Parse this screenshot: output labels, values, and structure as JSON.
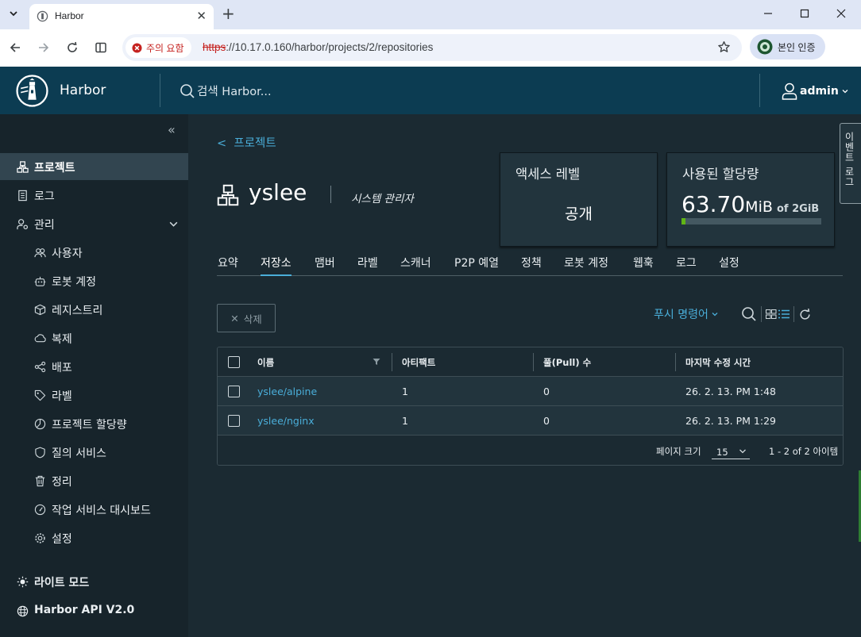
{
  "browser": {
    "tab_title": "Harbor",
    "security_label": "주의 요함",
    "url_scheme": "https",
    "url_rest": "://10.17.0.160/harbor/projects/2/repositories",
    "profile_label": "본인 인증"
  },
  "header": {
    "app_name": "Harbor",
    "search_placeholder": "검색 Harbor...",
    "user": "admin",
    "brand_color": "#0c3c52"
  },
  "sidebar": {
    "items": [
      {
        "label": "프로젝트",
        "icon": "projects-icon"
      },
      {
        "label": "로그",
        "icon": "log-icon"
      },
      {
        "label": "관리",
        "icon": "admin-icon"
      },
      {
        "label": "사용자",
        "icon": "users-icon"
      },
      {
        "label": "로봇 계정",
        "icon": "robot-icon"
      },
      {
        "label": "레지스트리",
        "icon": "registry-icon"
      },
      {
        "label": "복제",
        "icon": "replication-icon"
      },
      {
        "label": "배포",
        "icon": "distribution-icon"
      },
      {
        "label": "라벨",
        "icon": "label-icon"
      },
      {
        "label": "프로젝트 할당량",
        "icon": "quota-icon"
      },
      {
        "label": "질의 서비스",
        "icon": "interrogation-icon"
      },
      {
        "label": "정리",
        "icon": "trash-icon"
      },
      {
        "label": "작업 서비스 대시보드",
        "icon": "dashboard-icon"
      },
      {
        "label": "설정",
        "icon": "settings-icon"
      }
    ],
    "light_mode": "라이트 모드",
    "api": "Harbor API V2.0"
  },
  "project": {
    "breadcrumb": "프로젝트",
    "name": "yslee",
    "role": "시스템 관리자",
    "access_card": {
      "title": "액세스 레벨",
      "value": "공개"
    },
    "quota_card": {
      "title": "사용된 할당량",
      "used": "63.70",
      "unit": "MiB",
      "of_text": "of 2GiB",
      "used_fraction": 0.031
    }
  },
  "tabs": [
    "요약",
    "저장소",
    "맴버",
    "라벨",
    "스캐너",
    "P2P 예열",
    "정책",
    "로봇 계정",
    "웹훅",
    "로그",
    "설정"
  ],
  "actions": {
    "delete": "삭제",
    "push_command": "푸시 명령어"
  },
  "table": {
    "columns": [
      "이름",
      "아티팩트",
      "풀(Pull) 수",
      "마지막 수정 시간"
    ],
    "rows": [
      {
        "name": "yslee/alpine",
        "artifacts": "1",
        "pulls": "0",
        "modified": "26. 2. 13. PM 1:48"
      },
      {
        "name": "yslee/nginx",
        "artifacts": "1",
        "pulls": "0",
        "modified": "26. 2. 13. PM 1:29"
      }
    ],
    "page_size_label": "페이지 크기",
    "page_size": "15",
    "count_text": "1 - 2 of 2 아이템"
  },
  "event_log": "이벤트 로그"
}
